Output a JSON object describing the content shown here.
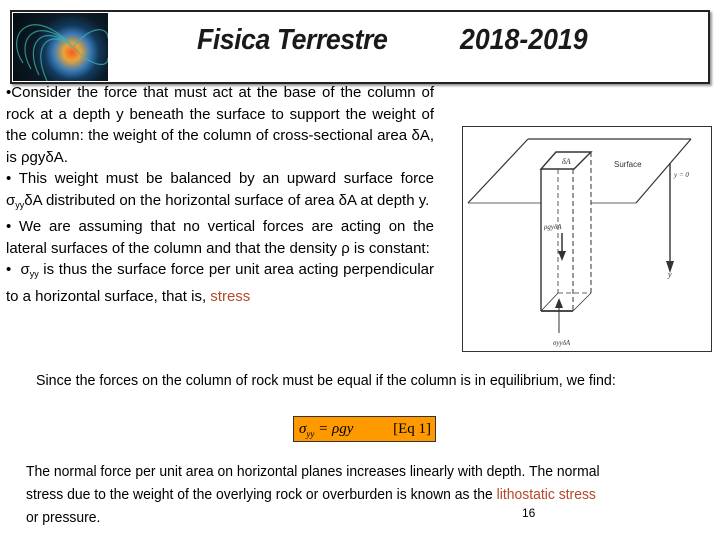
{
  "header": {
    "logo_icon": "earth-magnetosphere-image",
    "title": "Fisica Terrestre",
    "year": "2018-2019"
  },
  "bullets": [
    {
      "prefix": "•",
      "text": "Consider the force that must act at the base of the column of rock at a depth y beneath the surface to support the weight of the column: the weight of the column of cross-sectional area δA, is ρgyδA."
    },
    {
      "prefix": "•",
      "text_before": "This weight must be balanced by an upward surface force σ",
      "subscript": "yy",
      "text_after": "δA distributed on the horizontal surface of area δA at depth y."
    },
    {
      "prefix": "•",
      "text": "We are assuming that no vertical forces are acting on the lateral surfaces of the column and that the density ρ is constant:"
    },
    {
      "prefix": "•",
      "text_before": "σ",
      "subscript": "yy",
      "text_after": " is thus the surface force per unit area acting perpendicular to a horizontal surface, that is, ",
      "highlight": "stress"
    }
  ],
  "diagram": {
    "labels": {
      "top_area": "δA",
      "surface": "Surface",
      "y_zero": "y = 0",
      "y_axis": "y",
      "weight": "ρgyδA",
      "stress_force": "σyyδA"
    }
  },
  "equilibrium_text": "Since the forces on the column of rock must be equal if the column is in equilibrium, we find:",
  "equation": {
    "lhs_symbol": "σ",
    "lhs_subscript": "yy",
    "rhs": " = ρgy",
    "tag": "[Eq 1]",
    "background": "#ff9900"
  },
  "conclusion": {
    "line1": "The normal force per unit area on horizontal planes increases linearly with depth. The normal",
    "line2_before": "stress due to the weight of the overlying rock or overburden is known as the ",
    "line2_highlight": "lithostatic stress",
    "line3": "or pressure."
  },
  "page_number": "16",
  "colors": {
    "accent": "#b5462a",
    "equation_box": "#ff9900"
  }
}
